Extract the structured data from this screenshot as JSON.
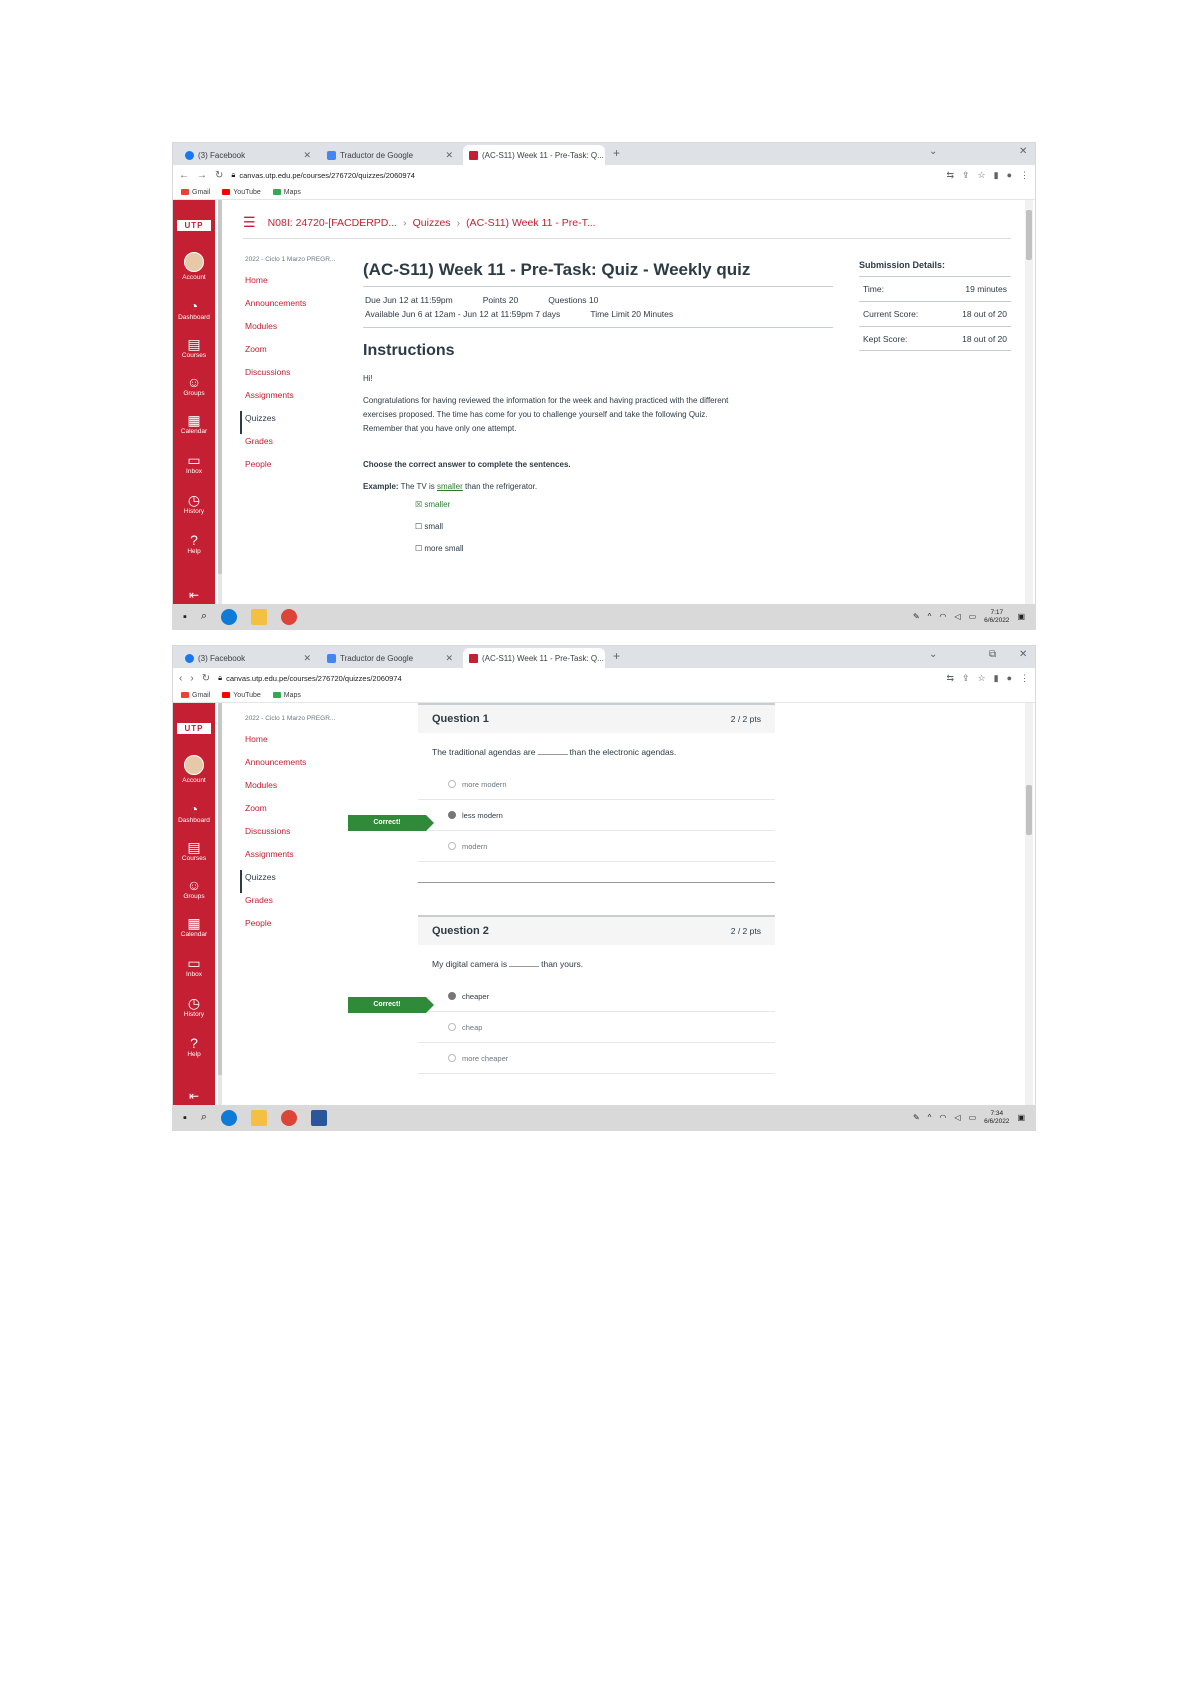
{
  "shot1": {
    "tabs": [
      {
        "label": "(3) Facebook"
      },
      {
        "label": "Traductor de Google"
      },
      {
        "label": "(AC-S11) Week 11 - Pre-Task: Q..."
      }
    ],
    "url": "canvas.utp.edu.pe/courses/276720/quizzes/2060974",
    "bookmarks": [
      "Gmail",
      "YouTube",
      "Maps"
    ],
    "globalnav": [
      "Account",
      "Dashboard",
      "Courses",
      "Groups",
      "Calendar",
      "Inbox",
      "History",
      "Help"
    ],
    "breadcrumb": {
      "course": "N08I: 24720-[FACDERPD...",
      "section": "Quizzes",
      "page": "(AC-S11) Week 11 - Pre-T..."
    },
    "course_term": "2022 - Ciclo 1 Marzo PREGR...",
    "course_nav": [
      "Home",
      "Announcements",
      "Modules",
      "Zoom",
      "Discussions",
      "Assignments",
      "Quizzes",
      "Grades",
      "People"
    ],
    "quiz_title": "(AC-S11) Week 11 - Pre-Task: Quiz - Weekly quiz",
    "meta": {
      "due": "Due Jun 12 at 11:59pm",
      "points": "Points 20",
      "questions": "Questions 10",
      "available": "Available Jun 6 at 12am - Jun 12 at 11:59pm 7 days",
      "time_limit": "Time Limit 20 Minutes"
    },
    "instructions_heading": "Instructions",
    "hi": "Hi!",
    "paragraph1": "Congratulations for having reviewed the information for the week and having practiced with the different",
    "paragraph2": "exercises proposed. The time has come for you to challenge yourself and take the following Quiz.",
    "paragraph3": "Remember that you have only one attempt.",
    "choose": "Choose the correct answer to complete the sentences.",
    "example_label": "Example:",
    "example_pre": "The TV is",
    "example_answer": "smaller",
    "example_post": "than the refrigerator.",
    "example_options": [
      "☒ smaller",
      "☐ small",
      "☐ more small"
    ],
    "submission": {
      "heading": "Submission Details:",
      "rows": [
        {
          "label": "Time:",
          "value": "19 minutes"
        },
        {
          "label": "Current Score:",
          "value": "18 out of 20"
        },
        {
          "label": "Kept Score:",
          "value": "18 out of 20"
        }
      ]
    },
    "clock": {
      "time": "7:17",
      "date": "6/6/2022"
    }
  },
  "shot2": {
    "tabs": [
      {
        "label": "(3) Facebook"
      },
      {
        "label": "Traductor de Google"
      },
      {
        "label": "(AC-S11) Week 11 - Pre-Task: Q..."
      }
    ],
    "url": "canvas.utp.edu.pe/courses/276720/quizzes/2060974",
    "bookmarks": [
      "Gmail",
      "YouTube",
      "Maps"
    ],
    "globalnav": [
      "Account",
      "Dashboard",
      "Courses",
      "Groups",
      "Calendar",
      "Inbox",
      "History",
      "Help"
    ],
    "course_term": "2022 - Ciclo 1 Marzo PREGR...",
    "course_nav": [
      "Home",
      "Announcements",
      "Modules",
      "Zoom",
      "Discussions",
      "Assignments",
      "Quizzes",
      "Grades",
      "People"
    ],
    "correct_label": "Correct!",
    "q1": {
      "title": "Question 1",
      "pts": "2 / 2 pts",
      "text_pre": "The traditional agendas are",
      "text_post": "than the electronic agendas.",
      "answers": [
        "more modern",
        "less modern",
        "modern"
      ]
    },
    "q2": {
      "title": "Question 2",
      "pts": "2 / 2 pts",
      "text_pre": "My digital camera is",
      "text_post": "than yours.",
      "answers": [
        "cheaper",
        "cheap",
        "more cheaper"
      ]
    },
    "clock": {
      "time": "7:34",
      "date": "6/6/2022"
    }
  }
}
